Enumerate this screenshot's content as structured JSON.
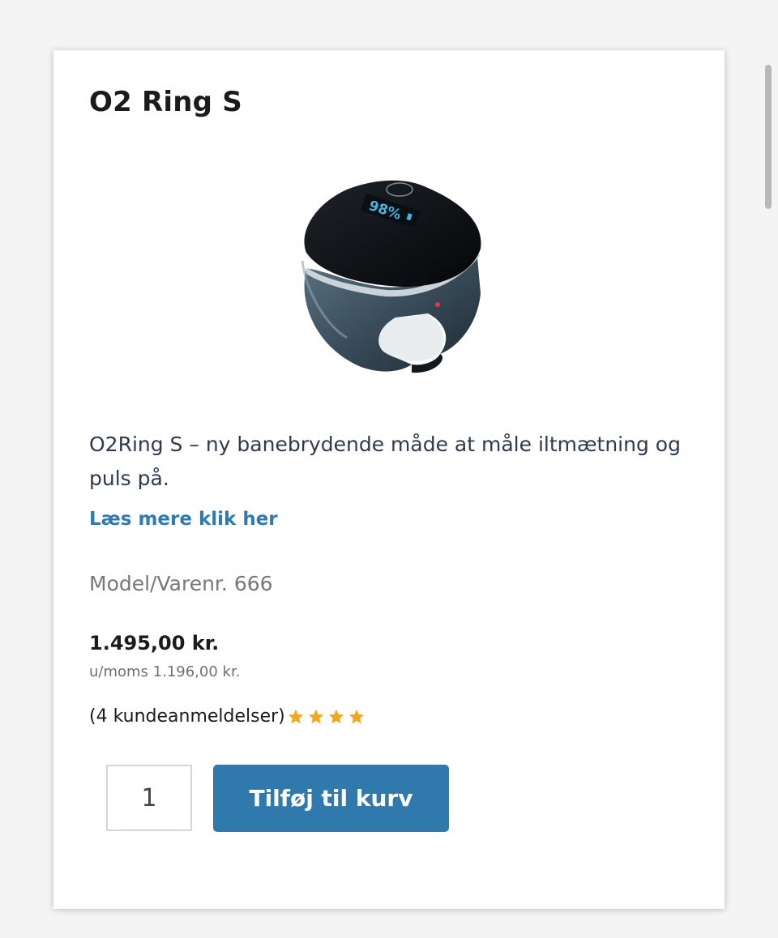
{
  "product": {
    "title": "O2 Ring S",
    "image_alt": "O2 Ring S ring oximeter",
    "device_display": "98%",
    "description": "O2Ring S – ny banebrydende måde at måle iltmætning og puls på.",
    "read_more_label": "Læs mere klik her",
    "model_label": "Model/Varenr.",
    "model_number": "666",
    "price": "1.495,00 kr.",
    "price_ex_vat": "u/moms 1.196,00 kr.",
    "reviews_label": "(4 kundeanmeldelser)",
    "rating_stars": 4
  },
  "cart": {
    "quantity": "1",
    "add_to_cart_label": "Tilføj til kurv"
  },
  "colors": {
    "accent": "#2f79ad",
    "link": "#2f7aae",
    "star": "#f2a81b"
  }
}
